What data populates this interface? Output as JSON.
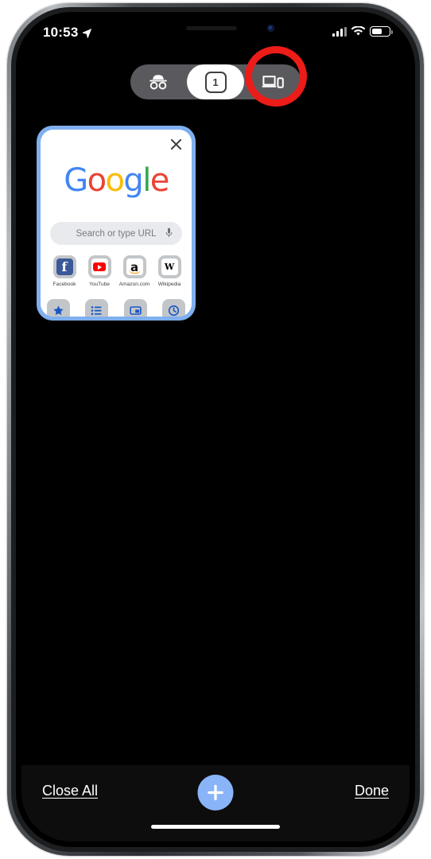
{
  "status_bar": {
    "time": "10:53",
    "location_icon": "location-arrow-icon",
    "cellular_icon": "cellular-bars-icon",
    "wifi_icon": "wifi-icon",
    "battery_icon": "battery-icon"
  },
  "segmented_control": {
    "items": [
      {
        "id": "incognito",
        "icon": "incognito-icon",
        "label": "",
        "selected": false
      },
      {
        "id": "regular-tabs",
        "icon": "tab-count-icon",
        "label": "1",
        "selected": true
      },
      {
        "id": "remote-devices",
        "icon": "devices-icon",
        "label": "",
        "selected": false
      }
    ],
    "highlight": {
      "target": "remote-devices",
      "shape": "circle",
      "color": "#ec1c18"
    }
  },
  "tab_grid": {
    "cards": [
      {
        "selected": true,
        "selection_color": "#7fafef",
        "close_icon": "close-icon",
        "page": {
          "logo": {
            "name": "google-logo",
            "letters": [
              {
                "char": "G",
                "color": "#4285f4"
              },
              {
                "char": "o",
                "color": "#ea4335"
              },
              {
                "char": "o",
                "color": "#fbbc05"
              },
              {
                "char": "g",
                "color": "#4285f4"
              },
              {
                "char": "l",
                "color": "#34a853"
              },
              {
                "char": "e",
                "color": "#ea4335"
              }
            ]
          },
          "search": {
            "placeholder": "Search or type URL",
            "value": "",
            "mic_icon": "microphone-icon"
          },
          "shortcuts": [
            {
              "label": "Facebook",
              "icon": "facebook-icon"
            },
            {
              "label": "YouTube",
              "icon": "youtube-icon"
            },
            {
              "label": "Amazon.com",
              "icon": "amazon-icon"
            },
            {
              "label": "Wikipedia",
              "icon": "wikipedia-icon"
            }
          ],
          "shortcuts_row2": [
            {
              "icon": "bookmark-star-icon"
            },
            {
              "icon": "reading-list-icon"
            },
            {
              "icon": "recent-tabs-icon"
            },
            {
              "icon": "history-icon"
            }
          ]
        }
      }
    ]
  },
  "bottom_bar": {
    "close_all_label": "Close All",
    "new_tab_icon": "plus-icon",
    "done_label": "Done",
    "accent_color": "#8ab4f8"
  }
}
